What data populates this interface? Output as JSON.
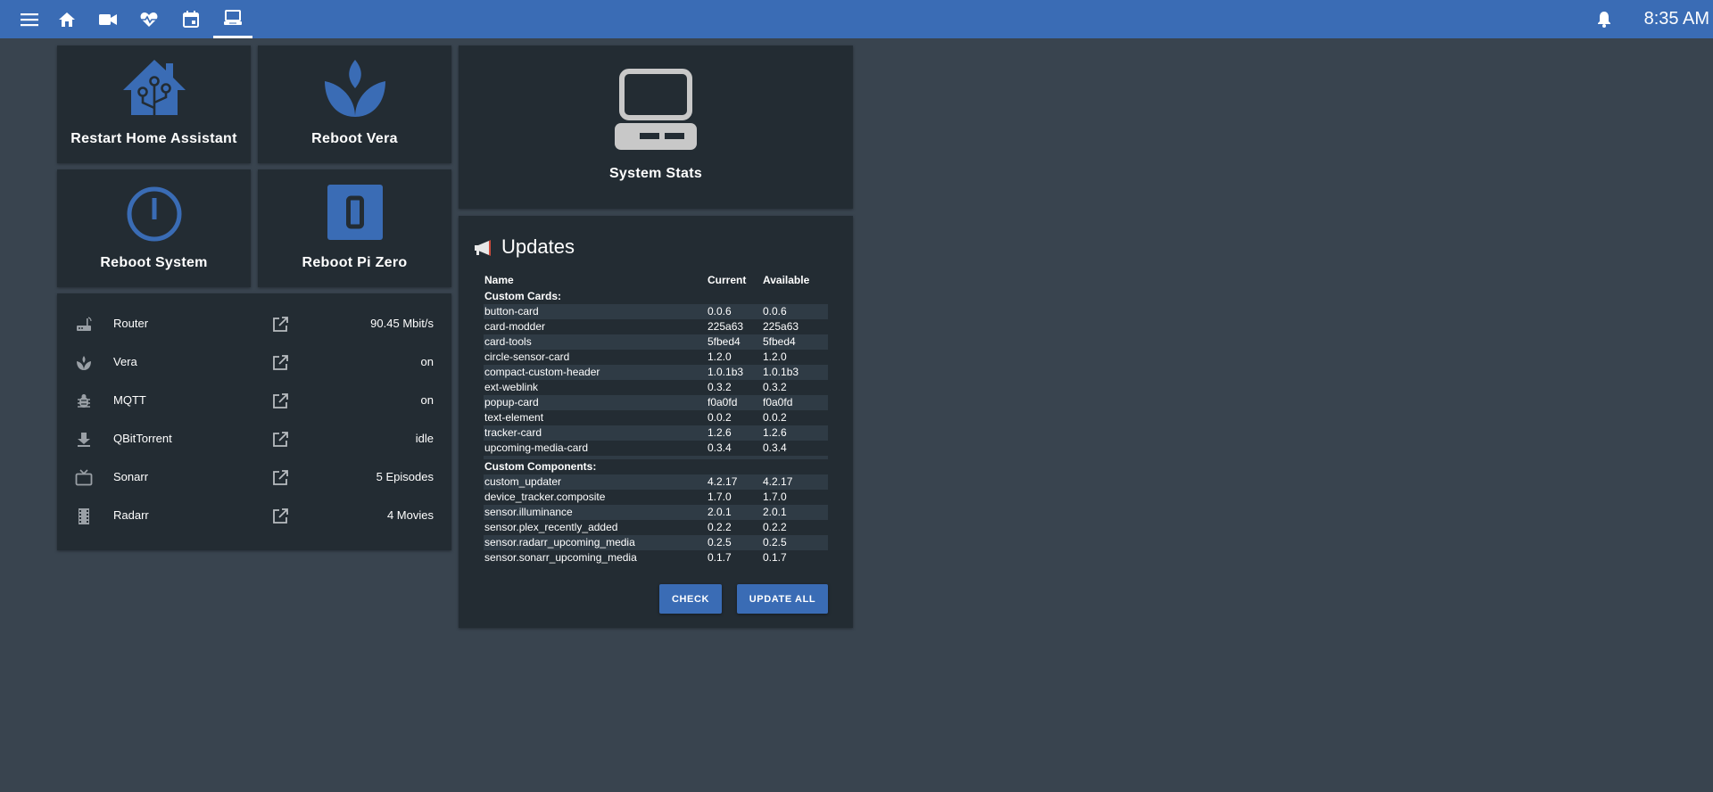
{
  "topbar": {
    "nav_icons": [
      "menu-icon",
      "home-icon",
      "camera-icon",
      "heart-pulse-icon",
      "calendar-icon",
      "laptop-icon"
    ],
    "active_tab": "laptop-icon",
    "time": "8:35 AM",
    "accent": "#3a6cb5"
  },
  "tiles": {
    "restart_ha": "Restart Home Assistant",
    "reboot_vera": "Reboot Vera",
    "reboot_system": "Reboot System",
    "reboot_pizero": "Reboot Pi Zero",
    "system_stats": "System Stats"
  },
  "entities": [
    {
      "icon": "router-icon",
      "name": "Router",
      "value": "90.45 Mbit/s"
    },
    {
      "icon": "vera-icon",
      "name": "Vera",
      "value": "on"
    },
    {
      "icon": "bug-icon",
      "name": "MQTT",
      "value": "on"
    },
    {
      "icon": "download-icon",
      "name": "QBitTorrent",
      "value": "idle"
    },
    {
      "icon": "tv-icon",
      "name": "Sonarr",
      "value": "5 Episodes"
    },
    {
      "icon": "film-icon",
      "name": "Radarr",
      "value": "4 Movies"
    }
  ],
  "updates": {
    "title": "Updates",
    "headers": {
      "name": "Name",
      "current": "Current",
      "available": "Available"
    },
    "section_cards": "Custom Cards:",
    "cards": [
      [
        "button-card",
        "0.0.6",
        "0.0.6"
      ],
      [
        "card-modder",
        "225a63",
        "225a63"
      ],
      [
        "card-tools",
        "5fbed4",
        "5fbed4"
      ],
      [
        "circle-sensor-card",
        "1.2.0",
        "1.2.0"
      ],
      [
        "compact-custom-header",
        "1.0.1b3",
        "1.0.1b3"
      ],
      [
        "ext-weblink",
        "0.3.2",
        "0.3.2"
      ],
      [
        "popup-card",
        "f0a0fd",
        "f0a0fd"
      ],
      [
        "text-element",
        "0.0.2",
        "0.0.2"
      ],
      [
        "tracker-card",
        "1.2.6",
        "1.2.6"
      ],
      [
        "upcoming-media-card",
        "0.3.4",
        "0.3.4"
      ]
    ],
    "section_components": "Custom Components:",
    "components": [
      [
        "custom_updater",
        "4.2.17",
        "4.2.17"
      ],
      [
        "device_tracker.composite",
        "1.7.0",
        "1.7.0"
      ],
      [
        "sensor.illuminance",
        "2.0.1",
        "2.0.1"
      ],
      [
        "sensor.plex_recently_added",
        "0.2.2",
        "0.2.2"
      ],
      [
        "sensor.radarr_upcoming_media",
        "0.2.5",
        "0.2.5"
      ],
      [
        "sensor.sonarr_upcoming_media",
        "0.1.7",
        "0.1.7"
      ]
    ],
    "check_label": "CHECK",
    "update_all_label": "UPDATE ALL"
  }
}
